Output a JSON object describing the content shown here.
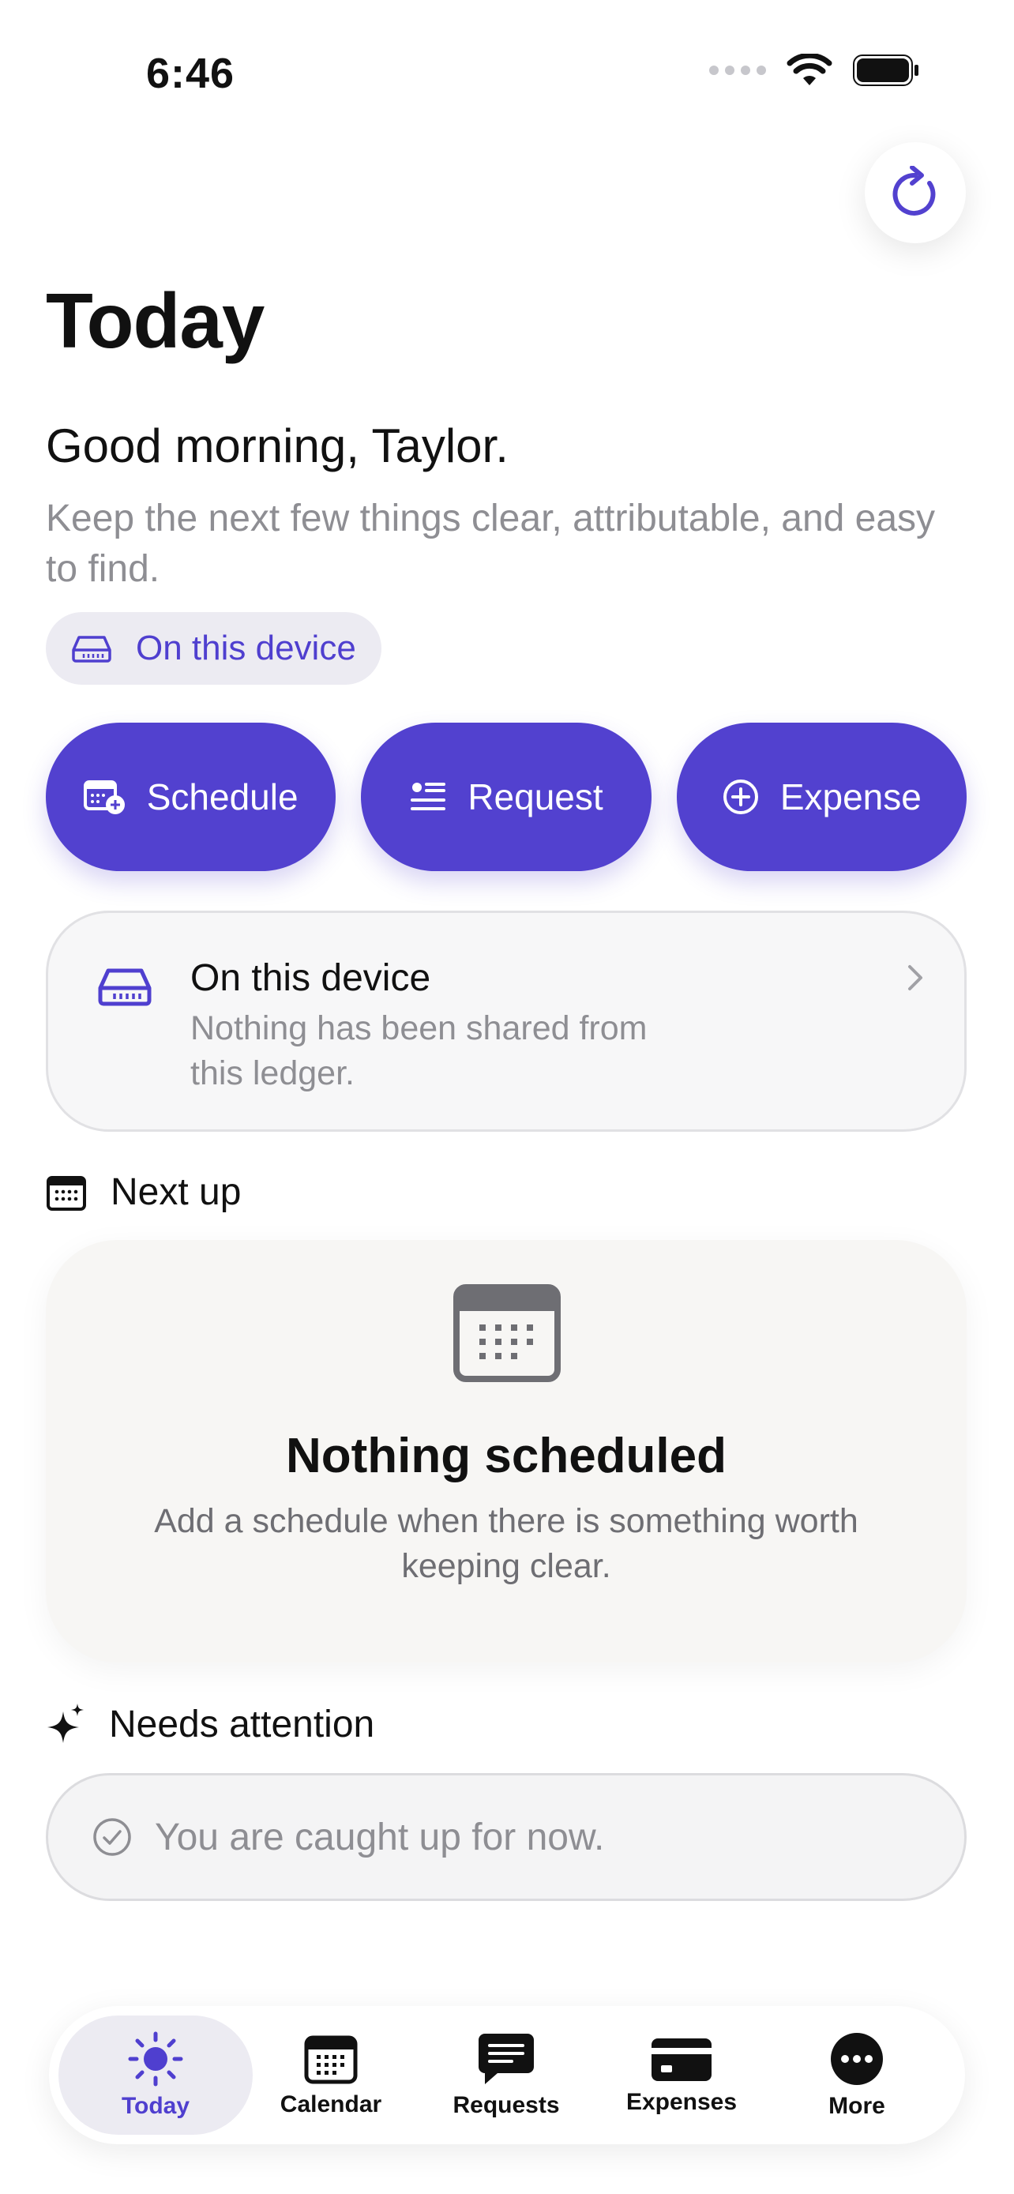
{
  "status_bar": {
    "time": "6:46"
  },
  "page": {
    "title": "Today",
    "greeting": "Good morning, Taylor.",
    "subtitle": "Keep the next few things clear, attributable, and easy to find.",
    "device_chip_label": "On this device"
  },
  "actions": [
    {
      "label": "Schedule",
      "icon": "calendar-add-icon"
    },
    {
      "label": "Request",
      "icon": "list-icon"
    },
    {
      "label": "Expense",
      "icon": "plus-circle-icon"
    }
  ],
  "device_card": {
    "title": "On this device",
    "description": "Nothing has been shared from this ledger."
  },
  "next_up": {
    "header": "Next up",
    "empty_title": "Nothing scheduled",
    "empty_description": "Add a schedule when there is something worth keeping clear."
  },
  "needs_attention": {
    "header": "Needs attention",
    "message": "You are caught up for now."
  },
  "tab_bar": [
    {
      "label": "Today",
      "icon": "sun-icon",
      "active": true
    },
    {
      "label": "Calendar",
      "icon": "calendar-icon",
      "active": false
    },
    {
      "label": "Requests",
      "icon": "message-icon",
      "active": false
    },
    {
      "label": "Expenses",
      "icon": "credit-card-icon",
      "active": false
    },
    {
      "label": "More",
      "icon": "more-icon",
      "active": false
    }
  ],
  "colors": {
    "accent": "#5241cf",
    "chip_background": "#ecebf2",
    "secondary_text": "#8e8e93"
  }
}
